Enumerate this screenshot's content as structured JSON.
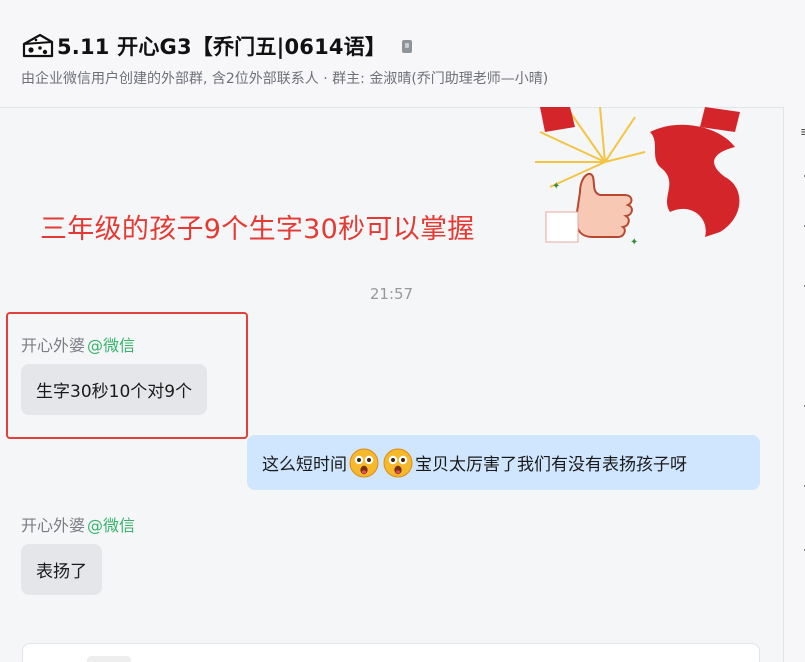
{
  "header": {
    "title": "5.11 开心G3【乔门五|0614语】",
    "subtitle": "由企业微信用户创建的外部群, 含2位外部联系人 · 群主: 金淑晴(乔门助理老师—小晴)",
    "title_icon": "cheese-icon",
    "lock_icon": "lock-icon"
  },
  "banner": {
    "text": "三年级的孩子9个生字30秒可以掌握",
    "sticker_icon": "thumbs-up-show-sticker"
  },
  "timestamp": "21:57",
  "messages": [
    {
      "sender": "开心外婆",
      "sender_tag": "@微信",
      "text": "生字30秒10个对9个",
      "direction": "in"
    },
    {
      "text_before": "这么短时间",
      "text_after": "宝贝太厉害了我们有没有表扬孩子呀",
      "emoji": "astonished-face",
      "direction": "out"
    },
    {
      "sender": "开心外婆",
      "sender_tag": "@微信",
      "text": "表扬了",
      "direction": "in"
    }
  ],
  "colors": {
    "accent_red": "#e53a33",
    "highlight_box": "#e0413b",
    "sender_tag": "#36b36b",
    "incoming_bubble": "#e4e6ea",
    "outgoing_bubble": "#cfe6fe"
  }
}
